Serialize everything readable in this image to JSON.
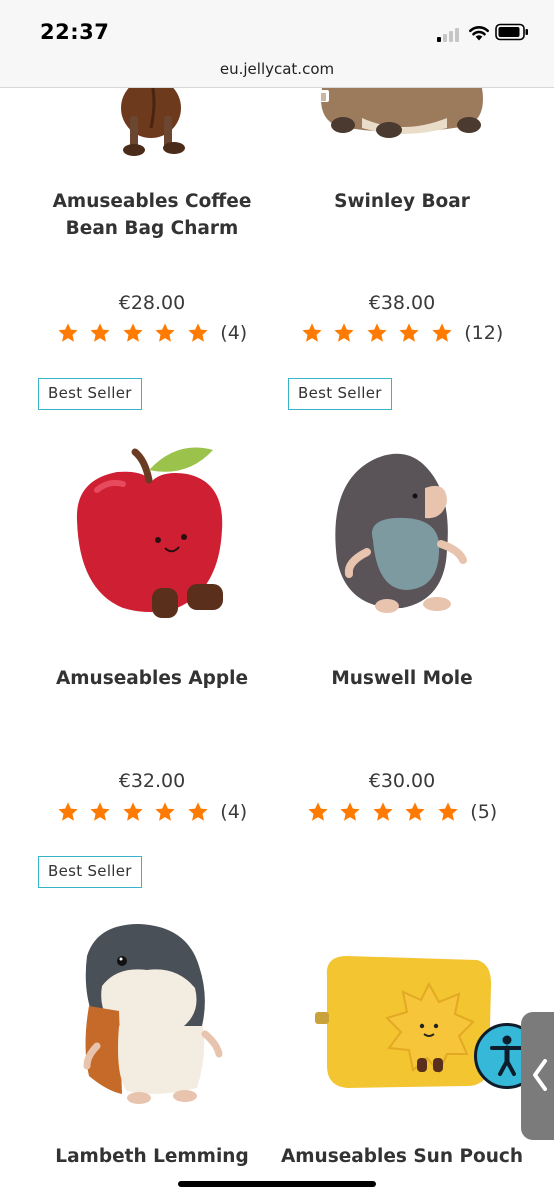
{
  "status_bar": {
    "time": "22:37",
    "icons": [
      "cellular-signal-icon",
      "wifi-icon",
      "battery-icon"
    ]
  },
  "browser": {
    "url": "eu.jellycat.com"
  },
  "theme": {
    "accent": "#38b4c9",
    "star_color": "#ff7a00",
    "a11y_color": "#36b9d8"
  },
  "products": [
    {
      "name": "Amuseables Coffee Bean Bag Charm",
      "price": "€28.00",
      "rating": 5,
      "review_count": "(4)",
      "badge": ""
    },
    {
      "name": "Swinley Boar",
      "price": "€38.00",
      "rating": 5,
      "review_count": "(12)",
      "badge": ""
    },
    {
      "name": "Amuseables Apple",
      "price": "€32.00",
      "rating": 5,
      "review_count": "(4)",
      "badge": "Best Seller"
    },
    {
      "name": "Muswell Mole",
      "price": "€30.00",
      "rating": 5,
      "review_count": "(5)",
      "badge": "Best Seller"
    },
    {
      "name": "Lambeth Lemming",
      "badge": "Best Seller"
    },
    {
      "name": "Amuseables Sun Pouch",
      "badge": ""
    }
  ],
  "overlays": {
    "accessibility_button": "accessibility-icon",
    "side_tab": "chevron-left-icon"
  }
}
